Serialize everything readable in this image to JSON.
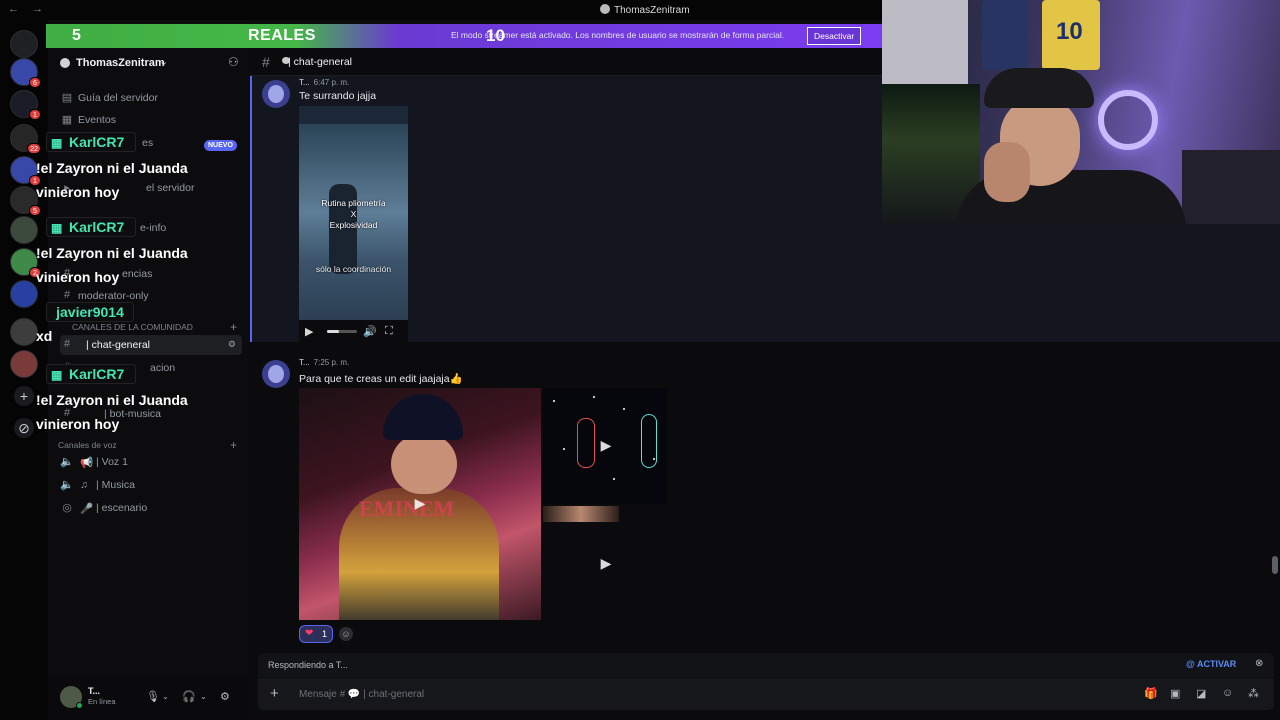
{
  "window": {
    "title": "ThomasZenitram",
    "back_glyph": "←",
    "fwd_glyph": "→"
  },
  "stream_overlay": {
    "left_number": "5",
    "center_label": "REALES",
    "number_10": "10",
    "notice": "El modo streamer está activado. Los nombres de usuario se mostrarán de forma parcial.",
    "deactivate_label": "Desactivar"
  },
  "alerts": [
    {
      "user": "KarlCR7",
      "message": "!el Zayron ni el Juanda vinieron hoy"
    },
    {
      "user": "KarlCR7",
      "message": "!el Zayron ni el Juanda vinieron hoy"
    },
    {
      "user": "javier9014",
      "message": "xd"
    },
    {
      "user": "KarlCR7",
      "message": "!el Zayron ni el Juanda vinieron hoy"
    }
  ],
  "server_rail": {
    "badges": [
      "6",
      "1",
      "22",
      "1",
      "5",
      "2"
    ]
  },
  "server": {
    "name": "ThomasZenitram",
    "chevron": "⌄",
    "add_person_icon": "person-add-icon"
  },
  "sidebar": {
    "items": [
      {
        "label": "Guía del servidor",
        "icon": "▤"
      },
      {
        "label": "Eventos",
        "icon": "▦"
      },
      {
        "label": "es",
        "icon": "◈"
      },
      {
        "label": "el servidor",
        "icon": "▸"
      },
      {
        "label": "e-info",
        "icon": "#"
      },
      {
        "label": "encias",
        "icon": "#"
      },
      {
        "label": "moderator-only",
        "icon": "#"
      },
      {
        "label": "| chat-general",
        "icon": "#"
      },
      {
        "label": "acion",
        "icon": "#"
      },
      {
        "label": "| bot-musica",
        "icon": "#"
      }
    ],
    "nuevo_badge": "NUEVO",
    "category_community": "CANALES DE LA COMUNIDAD",
    "category_voice": "Canales de voz",
    "voice_channels": [
      {
        "label": "| Voz 1",
        "emoji": "📢"
      },
      {
        "label": "| Musica",
        "emoji": "♫"
      },
      {
        "label": "| escenario",
        "emoji": "🎤"
      }
    ]
  },
  "user": {
    "name": "T...",
    "status": "En línea"
  },
  "chat": {
    "channel": "| chat-general",
    "messages": [
      {
        "author": "T...",
        "time": "6:47 p. m.",
        "text": "Te surrando jajja",
        "video_caption": "Rutina pliometría\nX\nExplosividad",
        "video_subcaption": "sólo la coordinación"
      },
      {
        "author": "T...",
        "time": "7:25 p. m.",
        "text": "Para que te creas un edit jaajaja👍"
      }
    ],
    "reaction": {
      "emoji": "❤",
      "count": "1"
    }
  },
  "reply": {
    "text": "Respondiendo a T...",
    "mention_toggle": "@ ACTIVAR",
    "close": "⊗"
  },
  "composer": {
    "placeholder": "Mensaje # 💬 | chat-general"
  },
  "webcam": {
    "jersey_number": "10"
  }
}
